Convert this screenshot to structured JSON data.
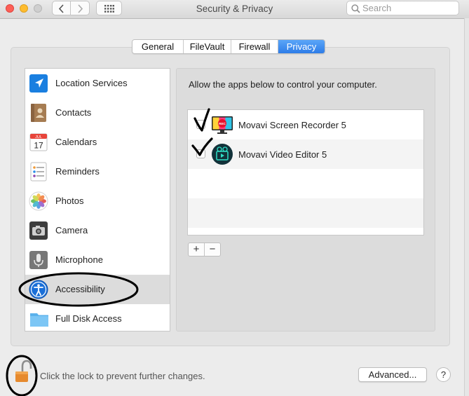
{
  "window": {
    "title": "Security & Privacy",
    "search_placeholder": "Search"
  },
  "tabs": [
    {
      "label": "General",
      "active": false
    },
    {
      "label": "FileVault",
      "active": false
    },
    {
      "label": "Firewall",
      "active": false
    },
    {
      "label": "Privacy",
      "active": true
    }
  ],
  "sidebar": {
    "selected": "Accessibility",
    "items": [
      {
        "label": "Location Services",
        "icon": "location-arrow-icon"
      },
      {
        "label": "Contacts",
        "icon": "contacts-book-icon"
      },
      {
        "label": "Calendars",
        "icon": "calendar-icon",
        "icon_text": [
          "JUL",
          "17"
        ]
      },
      {
        "label": "Reminders",
        "icon": "reminders-list-icon"
      },
      {
        "label": "Photos",
        "icon": "photos-flower-icon"
      },
      {
        "label": "Camera",
        "icon": "camera-icon"
      },
      {
        "label": "Microphone",
        "icon": "microphone-icon"
      },
      {
        "label": "Accessibility",
        "icon": "accessibility-person-icon"
      },
      {
        "label": "Full Disk Access",
        "icon": "folder-icon"
      }
    ]
  },
  "main": {
    "instruction": "Allow the apps below to control your computer.",
    "apps": [
      {
        "name": "Movavi Screen Recorder 5",
        "icon": "screen-recorder-icon",
        "icon_text": "REC"
      },
      {
        "name": "Movavi Video Editor 5",
        "icon": "video-editor-icon"
      }
    ],
    "add_label": "+",
    "remove_label": "−"
  },
  "footer": {
    "lock_text": "Click the lock to prevent further changes.",
    "advanced_label": "Advanced...",
    "help_label": "?"
  },
  "colors": {
    "accent": "#2e7de8",
    "annotation": "#000000"
  }
}
